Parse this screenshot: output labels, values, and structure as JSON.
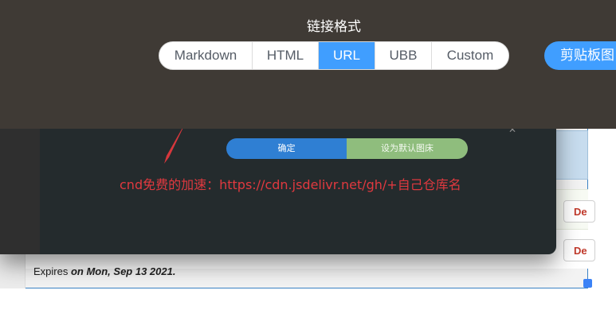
{
  "toolbar": {
    "title": "链接格式",
    "formats": [
      {
        "label": "Markdown",
        "active": false
      },
      {
        "label": "HTML",
        "active": false
      },
      {
        "label": "URL",
        "active": true
      },
      {
        "label": "UBB",
        "active": false
      },
      {
        "label": "Custom",
        "active": false
      }
    ],
    "clipboard_label": "剪贴板图"
  },
  "modal": {
    "confirm_label": "确定",
    "set_default_label": "设为默认图床",
    "close_glyph": "✕"
  },
  "annotation": {
    "text": "cnd免费的加速：https://cdn.jsdelivr.net/gh/+自己仓库名"
  },
  "page": {
    "delete_label_1": "De",
    "delete_label_2": "De",
    "expires_prefix": "Expires ",
    "expires_date": "on Mon, Sep 13 2021."
  },
  "colors": {
    "topbar": "#3f3a35",
    "accent": "#409eff",
    "annotation": "#e0393f",
    "confirm": "#2f7fd3",
    "set_default": "#8fbd7d"
  }
}
